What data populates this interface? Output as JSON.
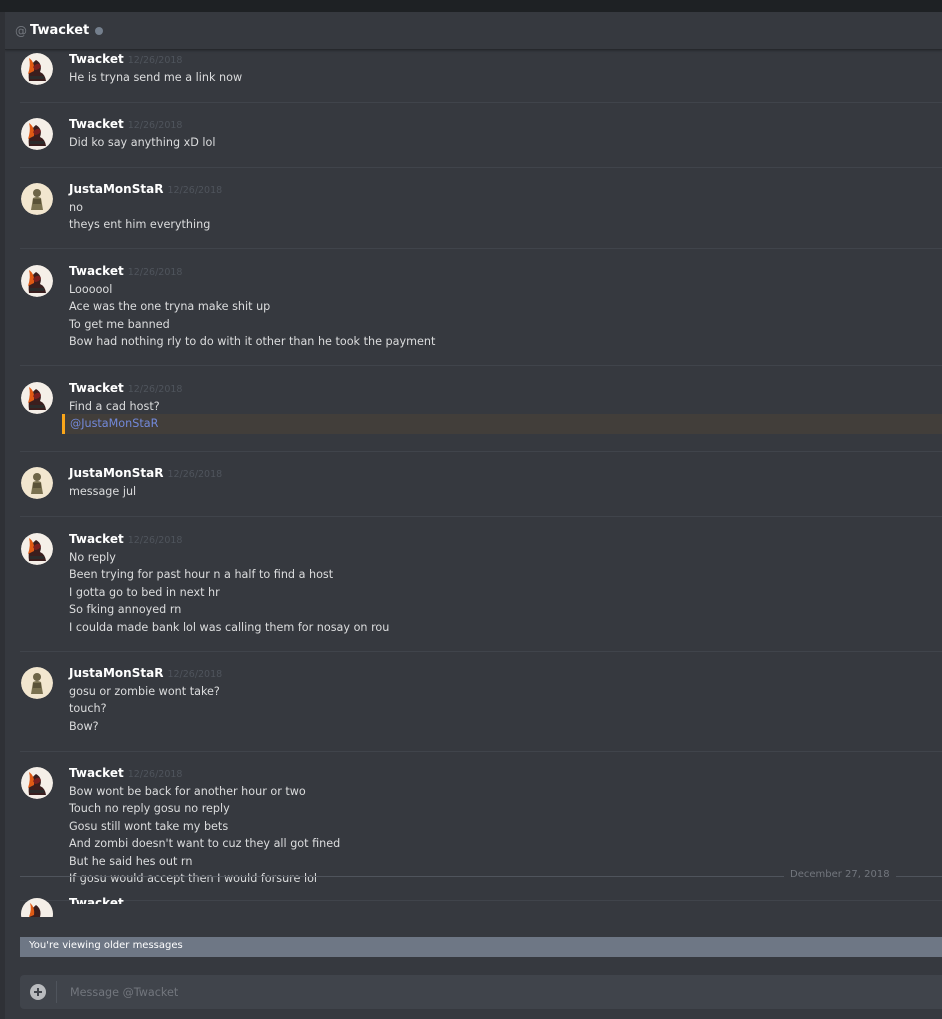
{
  "header": {
    "at_symbol": "@",
    "title": "Twacket"
  },
  "messages": [
    {
      "author": "Twacket",
      "timestamp": "12/26/2018",
      "avatar": "twacket",
      "lines": [
        "He is tryna send me a link now"
      ]
    },
    {
      "author": "Twacket",
      "timestamp": "12/26/2018",
      "avatar": "twacket",
      "lines": [
        "Did ko say anything xD lol"
      ]
    },
    {
      "author": "JustaMonStaR",
      "timestamp": "12/26/2018",
      "avatar": "justa",
      "lines": [
        "no",
        "theys ent him everything"
      ]
    },
    {
      "author": "Twacket",
      "timestamp": "12/26/2018",
      "avatar": "twacket",
      "lines": [
        "Loooool",
        "Ace was the one tryna make shit up",
        "To get me banned",
        "Bow had nothing rly to do with it other than he took the payment"
      ]
    },
    {
      "author": "Twacket",
      "timestamp": "12/26/2018",
      "avatar": "twacket",
      "lines": [
        "Find a cad host?"
      ],
      "mention": "@JustaMonStaR"
    },
    {
      "author": "JustaMonStaR",
      "timestamp": "12/26/2018",
      "avatar": "justa",
      "lines": [
        "message jul"
      ]
    },
    {
      "author": "Twacket",
      "timestamp": "12/26/2018",
      "avatar": "twacket",
      "lines": [
        "No reply",
        "Been trying for past hour n a half to find a host",
        "I gotta go to bed in next hr",
        "So fking annoyed rn",
        "I coulda made bank lol was calling them for nosay on rou"
      ]
    },
    {
      "author": "JustaMonStaR",
      "timestamp": "12/26/2018",
      "avatar": "justa",
      "lines": [
        "gosu or zombie wont take?",
        "touch?",
        "Bow?"
      ]
    },
    {
      "author": "Twacket",
      "timestamp": "12/26/2018",
      "avatar": "twacket",
      "lines": [
        "Bow wont be back for another hour or two",
        "Touch no reply gosu no reply",
        "Gosu still wont take my bets",
        "And zombi doesn't want to cuz they all got fined",
        "But he said hes out rn",
        "If gosu would accept then I would forsure lol"
      ]
    }
  ],
  "date_divider": "December 27, 2018",
  "partial_message": {
    "author": "Twacket"
  },
  "older_messages_bar": "You're viewing older messages",
  "composer": {
    "placeholder": "Message @Twacket"
  }
}
